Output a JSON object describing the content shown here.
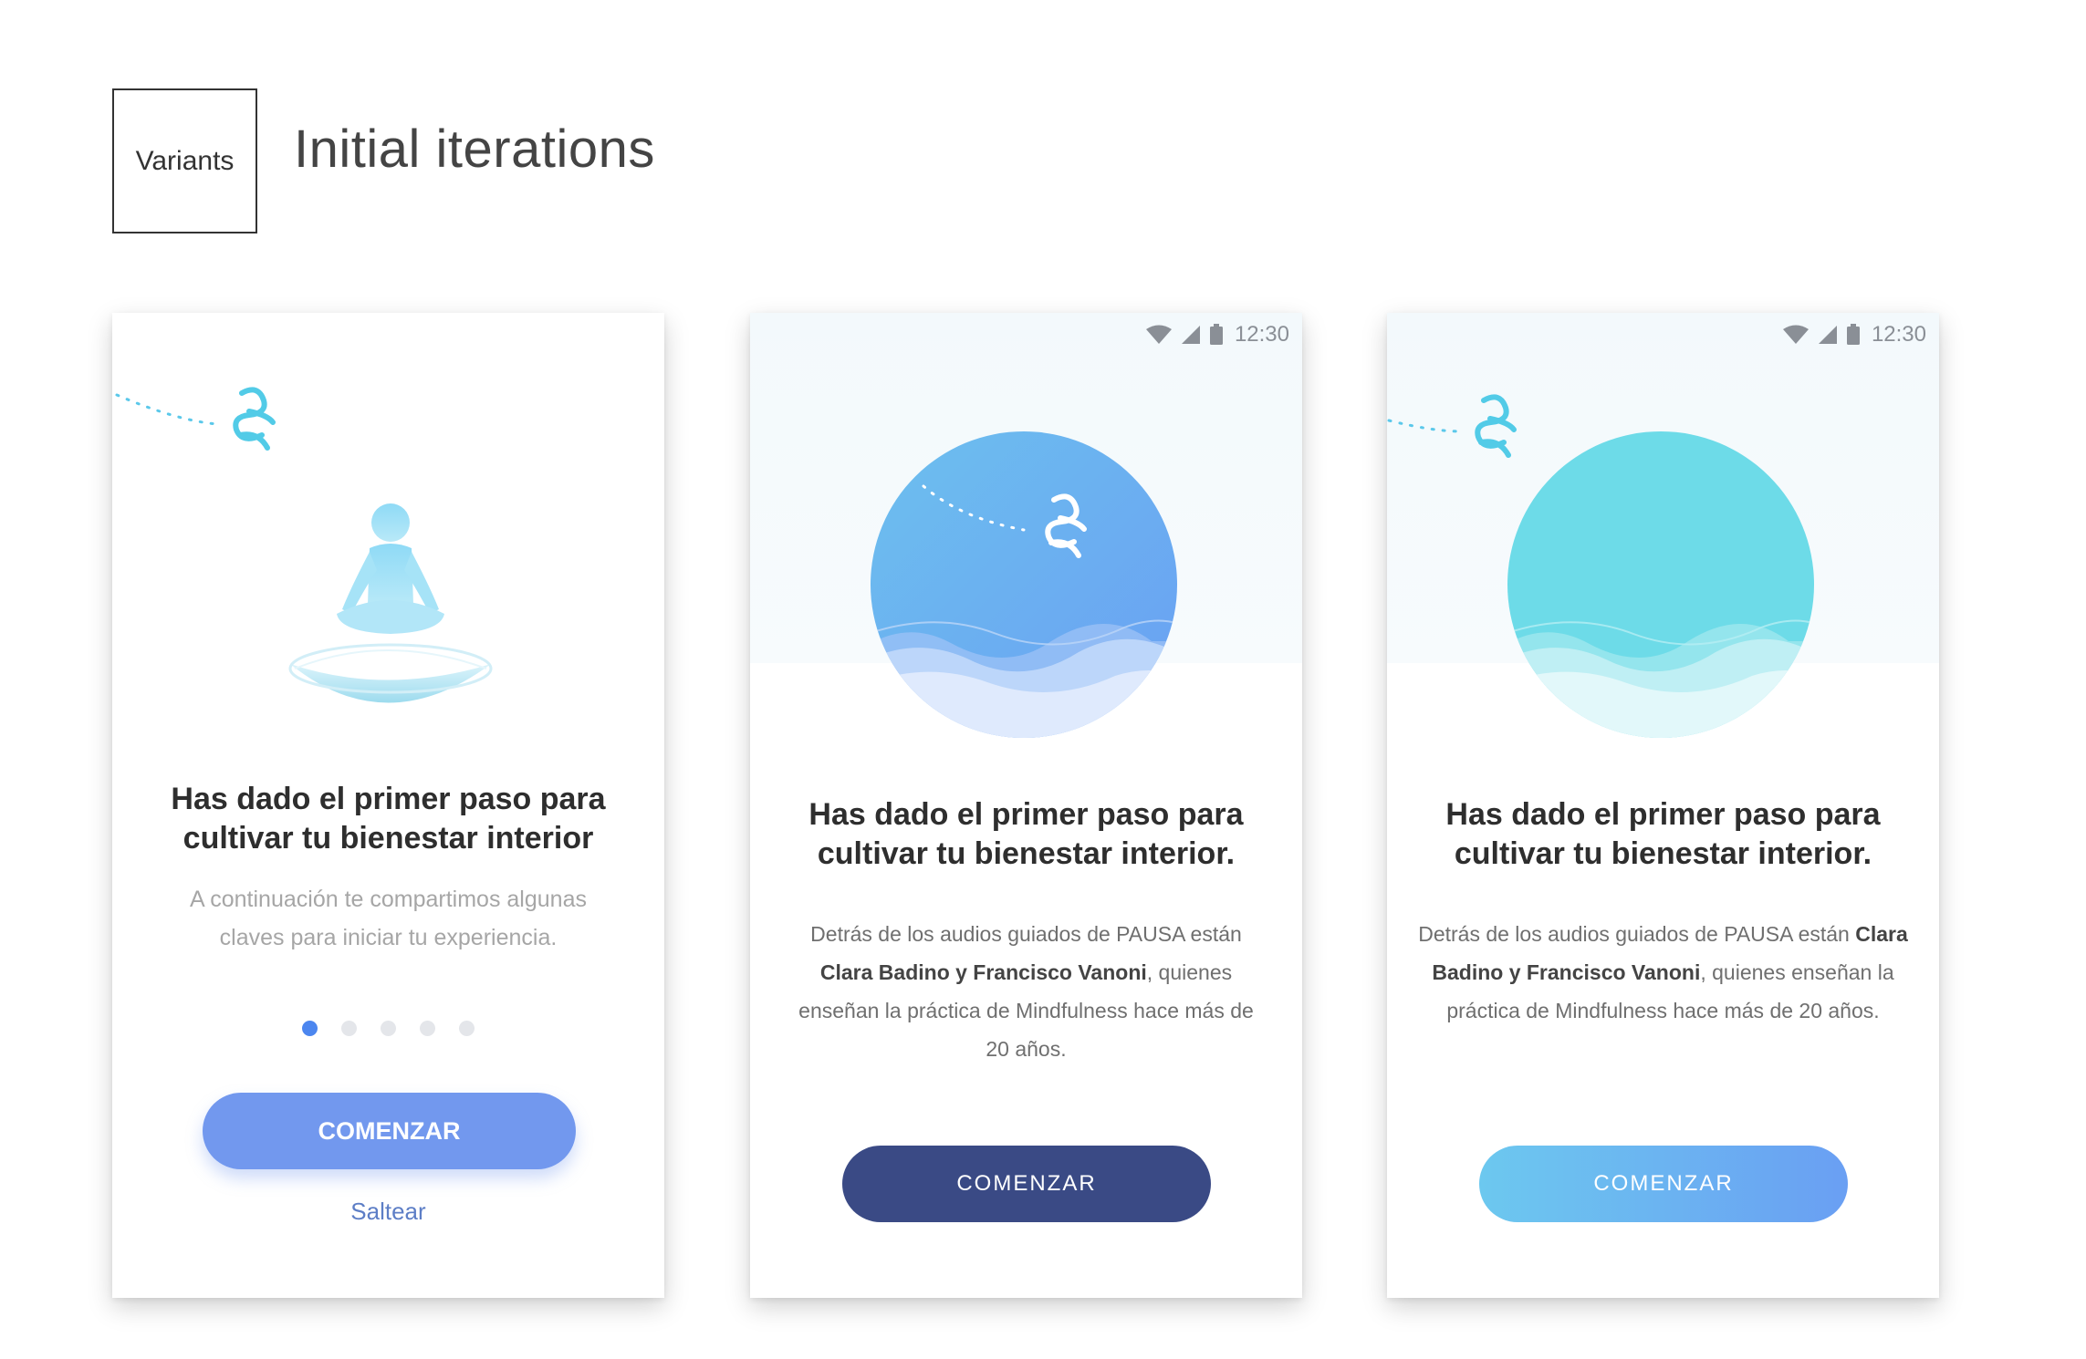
{
  "header": {
    "variants_label": "Variants",
    "title": "Initial iterations"
  },
  "cards": [
    {
      "heading_lines": [
        "Has dado el primer paso para",
        "cultivar tu bienestar interior"
      ],
      "subtitle_lines": [
        "A continuación te compartimos algunas",
        "claves para iniciar tu experiencia."
      ],
      "page_indicator": {
        "total": 5,
        "active": 1
      },
      "primary_button": "COMENZAR",
      "skip_link": "Saltear",
      "colors": {
        "button": "#7298ee",
        "dot_active": "#4c86ef",
        "link": "#5d7ec6"
      }
    },
    {
      "status_time": "12:30",
      "heading_lines": [
        "Has dado el primer paso para",
        "cultivar tu bienestar interior."
      ],
      "body": {
        "t1": "Detrás de los audios guiados de PAUSA están",
        "b1": "Clara Badino y Francisco Vanoni",
        "t2": ", quienes",
        "t3": "enseñan la práctica de Mindfulness hace más de",
        "t4": "20 años."
      },
      "primary_button": "COMENZAR",
      "colors": {
        "button": "#3a4a85",
        "circle_top": "#6cb6ee",
        "circle_bottom": "#6a9ff3"
      }
    },
    {
      "status_time": "12:30",
      "heading_lines": [
        "Has dado el primer paso para",
        "cultivar tu bienestar interior."
      ],
      "body": {
        "t1": "Detrás de los audios guiados de PAUSA están ",
        "b1": "Clara",
        "b2": "Badino y Francisco Vanoni",
        "t2": ", quienes enseñan la",
        "t3": "práctica de Mindfulness hace más de 20 años."
      },
      "primary_button": "COMENZAR",
      "colors": {
        "button_from": "#6cc8ef",
        "button_to": "#6a9ff3",
        "circle": "#6ddbe8"
      }
    }
  ],
  "icons": [
    "pausa-logo-icon",
    "meditation-figure-icon",
    "wifi-icon",
    "signal-icon",
    "battery-icon"
  ]
}
